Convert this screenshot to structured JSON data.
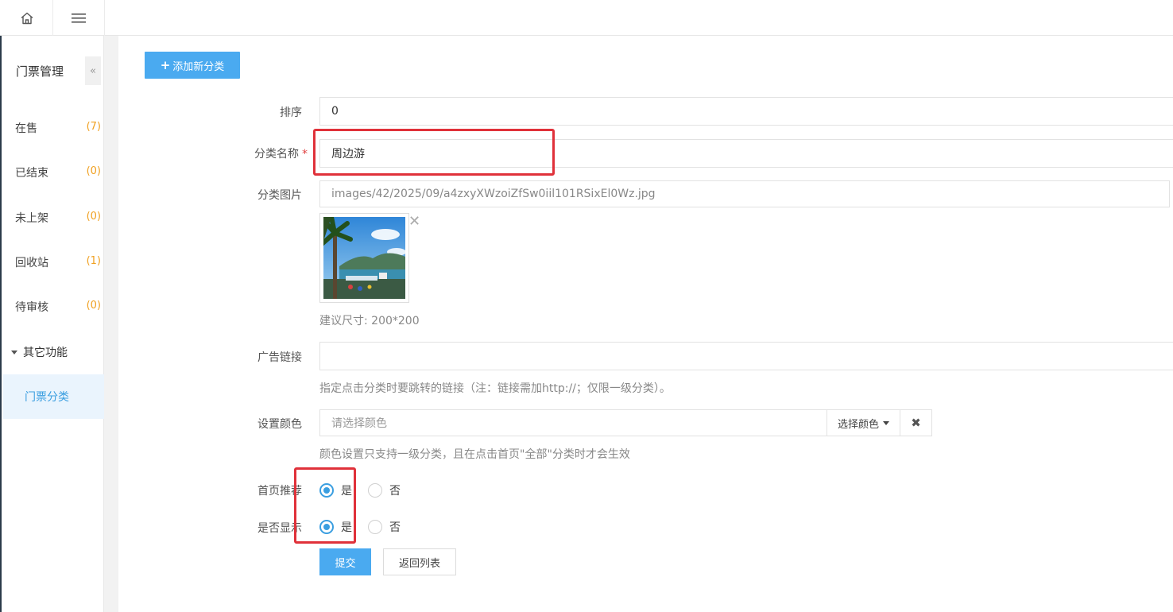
{
  "topbar": {
    "home_icon": "home-icon",
    "menu_icon": "hamburger-menu-icon"
  },
  "sidebar": {
    "title": "门票管理",
    "collapse_glyph": "«",
    "items": [
      {
        "label": "在售",
        "count": "(7)"
      },
      {
        "label": "已结束",
        "count": "(0)"
      },
      {
        "label": "未上架",
        "count": "(0)"
      },
      {
        "label": "回收站",
        "count": "(1)"
      },
      {
        "label": "待审核",
        "count": "(0)"
      }
    ],
    "group_label": "其它功能",
    "active_item": "门票分类"
  },
  "toolbar": {
    "add_label": "添加新分类"
  },
  "form": {
    "sort": {
      "label": "排序",
      "value": "0"
    },
    "name": {
      "label": "分类名称",
      "required_mark": "*",
      "value": "周边游"
    },
    "image": {
      "label": "分类图片",
      "value": "images/42/2025/09/a4zxyXWzoiZfSw0iil101RSixEl0Wz.jpg",
      "remove_glyph": "✕",
      "hint": "建议尺寸: 200*200"
    },
    "ad_link": {
      "label": "广告链接",
      "value": "",
      "hint": "指定点击分类时要跳转的链接（注：链接需加http://；仅限一级分类）。"
    },
    "color": {
      "label": "设置颜色",
      "placeholder": "请选择颜色",
      "select_label": "选择颜色",
      "clear_glyph": "✖",
      "hint": "颜色设置只支持一级分类，且在点击首页\"全部\"分类时才会生效"
    },
    "home_recommend": {
      "label": "首页推荐",
      "yes": "是",
      "no": "否",
      "selected": "是"
    },
    "visible": {
      "label": "是否显示",
      "yes": "是",
      "no": "否",
      "selected": "是"
    },
    "submit_label": "提交",
    "back_label": "返回列表"
  },
  "colors": {
    "accent": "#4aaaf0",
    "highlight": "#e0313a",
    "count": "#f0a020"
  }
}
